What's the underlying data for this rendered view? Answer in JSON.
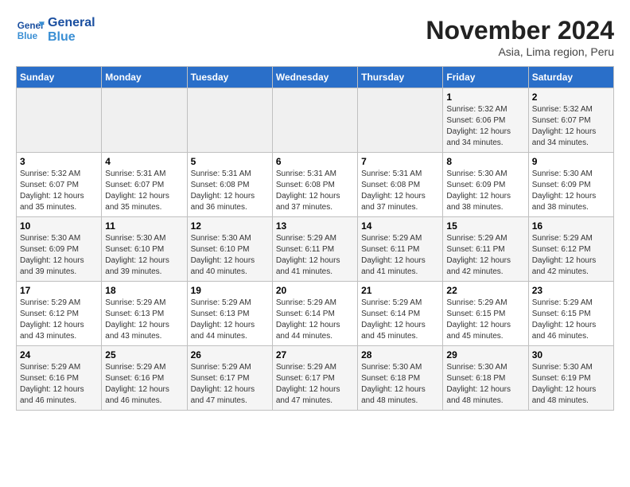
{
  "header": {
    "logo_line1": "General",
    "logo_line2": "Blue",
    "title": "November 2024",
    "subtitle": "Asia, Lima region, Peru"
  },
  "weekdays": [
    "Sunday",
    "Monday",
    "Tuesday",
    "Wednesday",
    "Thursday",
    "Friday",
    "Saturday"
  ],
  "weeks": [
    [
      {
        "day": "",
        "info": ""
      },
      {
        "day": "",
        "info": ""
      },
      {
        "day": "",
        "info": ""
      },
      {
        "day": "",
        "info": ""
      },
      {
        "day": "",
        "info": ""
      },
      {
        "day": "1",
        "info": "Sunrise: 5:32 AM\nSunset: 6:06 PM\nDaylight: 12 hours and 34 minutes."
      },
      {
        "day": "2",
        "info": "Sunrise: 5:32 AM\nSunset: 6:07 PM\nDaylight: 12 hours and 34 minutes."
      }
    ],
    [
      {
        "day": "3",
        "info": "Sunrise: 5:32 AM\nSunset: 6:07 PM\nDaylight: 12 hours and 35 minutes."
      },
      {
        "day": "4",
        "info": "Sunrise: 5:31 AM\nSunset: 6:07 PM\nDaylight: 12 hours and 35 minutes."
      },
      {
        "day": "5",
        "info": "Sunrise: 5:31 AM\nSunset: 6:08 PM\nDaylight: 12 hours and 36 minutes."
      },
      {
        "day": "6",
        "info": "Sunrise: 5:31 AM\nSunset: 6:08 PM\nDaylight: 12 hours and 37 minutes."
      },
      {
        "day": "7",
        "info": "Sunrise: 5:31 AM\nSunset: 6:08 PM\nDaylight: 12 hours and 37 minutes."
      },
      {
        "day": "8",
        "info": "Sunrise: 5:30 AM\nSunset: 6:09 PM\nDaylight: 12 hours and 38 minutes."
      },
      {
        "day": "9",
        "info": "Sunrise: 5:30 AM\nSunset: 6:09 PM\nDaylight: 12 hours and 38 minutes."
      }
    ],
    [
      {
        "day": "10",
        "info": "Sunrise: 5:30 AM\nSunset: 6:09 PM\nDaylight: 12 hours and 39 minutes."
      },
      {
        "day": "11",
        "info": "Sunrise: 5:30 AM\nSunset: 6:10 PM\nDaylight: 12 hours and 39 minutes."
      },
      {
        "day": "12",
        "info": "Sunrise: 5:30 AM\nSunset: 6:10 PM\nDaylight: 12 hours and 40 minutes."
      },
      {
        "day": "13",
        "info": "Sunrise: 5:29 AM\nSunset: 6:11 PM\nDaylight: 12 hours and 41 minutes."
      },
      {
        "day": "14",
        "info": "Sunrise: 5:29 AM\nSunset: 6:11 PM\nDaylight: 12 hours and 41 minutes."
      },
      {
        "day": "15",
        "info": "Sunrise: 5:29 AM\nSunset: 6:11 PM\nDaylight: 12 hours and 42 minutes."
      },
      {
        "day": "16",
        "info": "Sunrise: 5:29 AM\nSunset: 6:12 PM\nDaylight: 12 hours and 42 minutes."
      }
    ],
    [
      {
        "day": "17",
        "info": "Sunrise: 5:29 AM\nSunset: 6:12 PM\nDaylight: 12 hours and 43 minutes."
      },
      {
        "day": "18",
        "info": "Sunrise: 5:29 AM\nSunset: 6:13 PM\nDaylight: 12 hours and 43 minutes."
      },
      {
        "day": "19",
        "info": "Sunrise: 5:29 AM\nSunset: 6:13 PM\nDaylight: 12 hours and 44 minutes."
      },
      {
        "day": "20",
        "info": "Sunrise: 5:29 AM\nSunset: 6:14 PM\nDaylight: 12 hours and 44 minutes."
      },
      {
        "day": "21",
        "info": "Sunrise: 5:29 AM\nSunset: 6:14 PM\nDaylight: 12 hours and 45 minutes."
      },
      {
        "day": "22",
        "info": "Sunrise: 5:29 AM\nSunset: 6:15 PM\nDaylight: 12 hours and 45 minutes."
      },
      {
        "day": "23",
        "info": "Sunrise: 5:29 AM\nSunset: 6:15 PM\nDaylight: 12 hours and 46 minutes."
      }
    ],
    [
      {
        "day": "24",
        "info": "Sunrise: 5:29 AM\nSunset: 6:16 PM\nDaylight: 12 hours and 46 minutes."
      },
      {
        "day": "25",
        "info": "Sunrise: 5:29 AM\nSunset: 6:16 PM\nDaylight: 12 hours and 46 minutes."
      },
      {
        "day": "26",
        "info": "Sunrise: 5:29 AM\nSunset: 6:17 PM\nDaylight: 12 hours and 47 minutes."
      },
      {
        "day": "27",
        "info": "Sunrise: 5:29 AM\nSunset: 6:17 PM\nDaylight: 12 hours and 47 minutes."
      },
      {
        "day": "28",
        "info": "Sunrise: 5:30 AM\nSunset: 6:18 PM\nDaylight: 12 hours and 48 minutes."
      },
      {
        "day": "29",
        "info": "Sunrise: 5:30 AM\nSunset: 6:18 PM\nDaylight: 12 hours and 48 minutes."
      },
      {
        "day": "30",
        "info": "Sunrise: 5:30 AM\nSunset: 6:19 PM\nDaylight: 12 hours and 48 minutes."
      }
    ]
  ]
}
